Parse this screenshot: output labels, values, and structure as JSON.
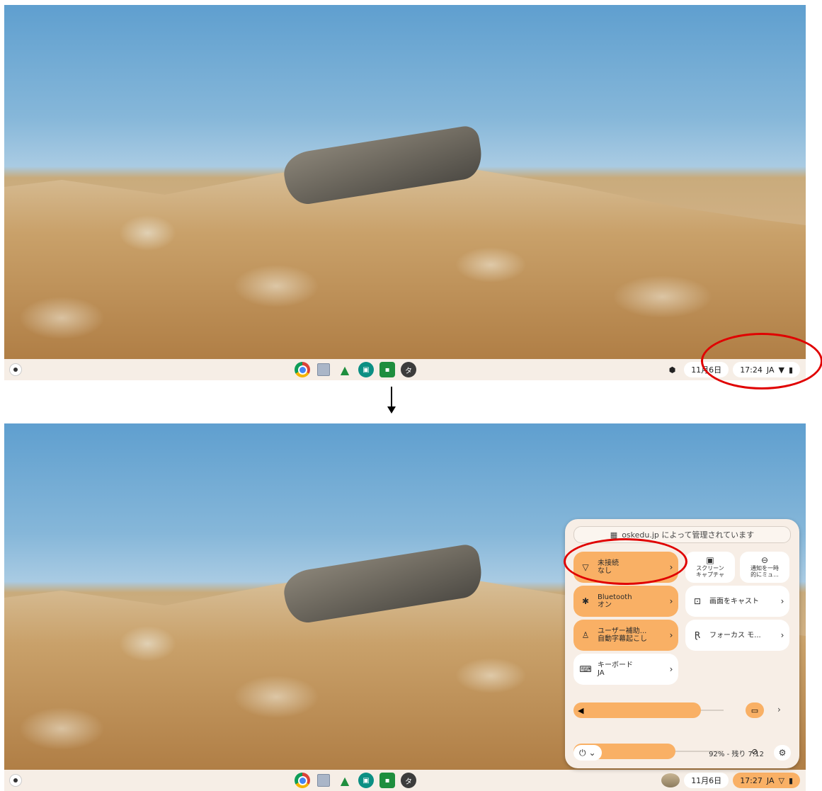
{
  "shelf_top": {
    "date": "11月6日",
    "time": "17:24",
    "ime": "JA"
  },
  "shelf_bottom": {
    "date": "11月6日",
    "time": "17:27",
    "ime": "JA"
  },
  "quick_settings": {
    "managed_text": "oskedu.jp によって管理されています",
    "network": {
      "title": "未接続",
      "sub": "なし"
    },
    "screen_capture": {
      "line1": "スクリーン",
      "line2": "キャプチャ"
    },
    "dnd": {
      "line1": "通知を一時",
      "line2": "的にミュ..."
    },
    "bluetooth": {
      "title": "Bluetooth",
      "sub": "オン"
    },
    "cast": {
      "title": "画面をキャスト"
    },
    "accessibility": {
      "title": "ユーザー補助...",
      "sub": "自動字幕起こし"
    },
    "focus": {
      "title": "フォーカス モ..."
    },
    "keyboard": {
      "title": "キーボード",
      "sub": "JA"
    },
    "volume_level": 0.85,
    "brightness_level": 0.68,
    "battery_text": "92% - 残り 7:12"
  },
  "icons": {
    "shelf_apps": [
      "chrome-icon",
      "files-icon",
      "drive-icon",
      "meet-icon",
      "classroom-icon",
      "ta-icon"
    ],
    "tray": [
      "shield-icon",
      "wifi-icon",
      "battery-icon"
    ]
  },
  "colors": {
    "accent": "#f9b065",
    "annotation": "#e00000"
  },
  "app_glyph_ta": "タ"
}
